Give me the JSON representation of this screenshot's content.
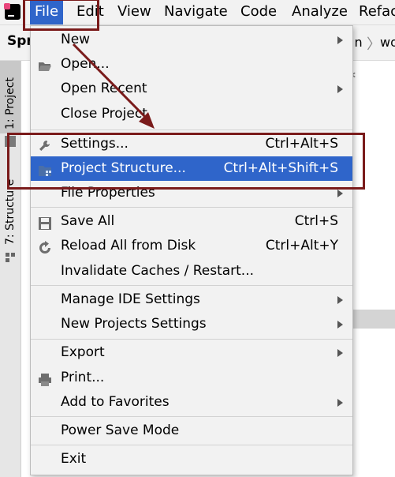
{
  "menubar": {
    "items": [
      "File",
      "Edit",
      "View",
      "Navigate",
      "Code",
      "Analyze",
      "Refac"
    ],
    "active_index": 0
  },
  "toolbar": {
    "project_name": "Spr",
    "crumb_main": "in",
    "crumb_sep": "〉",
    "crumb_next": "wo"
  },
  "sidebar": {
    "project_tab": "1: Project",
    "structure_tab": "7: Structure"
  },
  "file_menu": {
    "items": [
      {
        "label": "New",
        "shortcut": "",
        "submenu": true,
        "icon": ""
      },
      {
        "label": "Open...",
        "shortcut": "",
        "submenu": false,
        "icon": "folder-open-icon"
      },
      {
        "label": "Open Recent",
        "shortcut": "",
        "submenu": true,
        "icon": ""
      },
      {
        "label": "Close Project",
        "shortcut": "",
        "submenu": false,
        "icon": ""
      },
      {
        "label": "Settings...",
        "shortcut": "Ctrl+Alt+S",
        "submenu": false,
        "icon": "wrench-icon"
      },
      {
        "label": "Project Structure...",
        "shortcut": "Ctrl+Alt+Shift+S",
        "submenu": false,
        "icon": "project-structure-icon",
        "selected": true
      },
      {
        "label": "File Properties",
        "shortcut": "",
        "submenu": true,
        "icon": ""
      },
      {
        "label": "Save All",
        "shortcut": "Ctrl+S",
        "submenu": false,
        "icon": "save-icon"
      },
      {
        "label": "Reload All from Disk",
        "shortcut": "Ctrl+Alt+Y",
        "submenu": false,
        "icon": "reload-icon"
      },
      {
        "label": "Invalidate Caches / Restart...",
        "shortcut": "",
        "submenu": false,
        "icon": ""
      },
      {
        "label": "Manage IDE Settings",
        "shortcut": "",
        "submenu": true,
        "icon": ""
      },
      {
        "label": "New Projects Settings",
        "shortcut": "",
        "submenu": true,
        "icon": ""
      },
      {
        "label": "Export",
        "shortcut": "",
        "submenu": true,
        "icon": ""
      },
      {
        "label": "Print...",
        "shortcut": "",
        "submenu": false,
        "icon": "printer-icon"
      },
      {
        "label": "Add to Favorites",
        "shortcut": "",
        "submenu": true,
        "icon": ""
      },
      {
        "label": "Power Save Mode",
        "shortcut": "",
        "submenu": false,
        "icon": ""
      },
      {
        "label": "Exit",
        "shortcut": "",
        "submenu": false,
        "icon": ""
      }
    ]
  },
  "colors": {
    "selection": "#2f65ca",
    "annotation": "#7a1b1b",
    "menu_bg": "#f2f2f2"
  }
}
